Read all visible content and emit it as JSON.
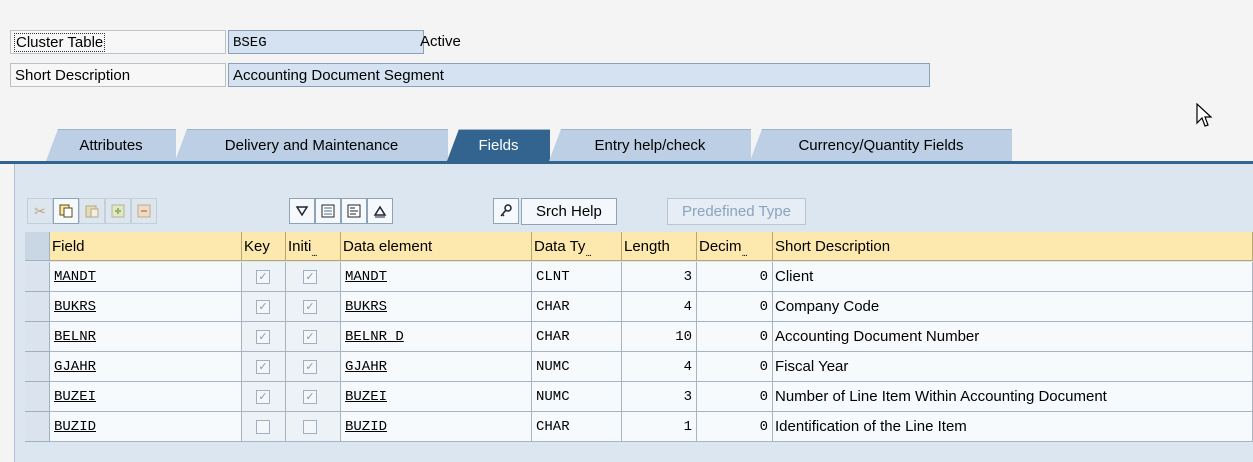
{
  "header": {
    "table_type_label": "Cluster Table",
    "table_name": "BSEG",
    "status": "Active",
    "short_desc_label": "Short Description",
    "short_desc_value": "Accounting Document Segment"
  },
  "tabs": [
    {
      "label": "Attributes",
      "active": false
    },
    {
      "label": "Delivery and Maintenance",
      "active": false
    },
    {
      "label": "Fields",
      "active": true
    },
    {
      "label": "Entry help/check",
      "active": false
    },
    {
      "label": "Currency/Quantity Fields",
      "active": false
    }
  ],
  "toolbar": {
    "icons": [
      "cut-icon",
      "copy-icon",
      "paste-icon",
      "insert-row-icon",
      "delete-row-icon",
      "find-icon",
      "include-icon",
      "append-structure-icon",
      "find-next-icon",
      "search-help-icon"
    ],
    "srch_help_label": "Srch Help",
    "predefined_type_label": "Predefined Type"
  },
  "table": {
    "columns": {
      "field": "Field",
      "key": "Key",
      "initial": "Initi",
      "data_element": "Data element",
      "data_type": "Data Ty",
      "length": "Length",
      "decimals": "Decim",
      "short_description": "Short Description"
    },
    "rows": [
      {
        "field": "MANDT",
        "key": true,
        "initial": true,
        "data_element": "MANDT",
        "data_type": "CLNT",
        "length": "3",
        "decimals": "0",
        "short_description": "Client"
      },
      {
        "field": "BUKRS",
        "key": true,
        "initial": true,
        "data_element": "BUKRS",
        "data_type": "CHAR",
        "length": "4",
        "decimals": "0",
        "short_description": "Company Code"
      },
      {
        "field": "BELNR",
        "key": true,
        "initial": true,
        "data_element": "BELNR_D",
        "data_type": "CHAR",
        "length": "10",
        "decimals": "0",
        "short_description": "Accounting Document Number"
      },
      {
        "field": "GJAHR",
        "key": true,
        "initial": true,
        "data_element": "GJAHR",
        "data_type": "NUMC",
        "length": "4",
        "decimals": "0",
        "short_description": "Fiscal Year"
      },
      {
        "field": "BUZEI",
        "key": true,
        "initial": true,
        "data_element": "BUZEI",
        "data_type": "NUMC",
        "length": "3",
        "decimals": "0",
        "short_description": "Number of Line Item Within Accounting Document"
      },
      {
        "field": "BUZID",
        "key": false,
        "initial": false,
        "data_element": "BUZID",
        "data_type": "CHAR",
        "length": "1",
        "decimals": "0",
        "short_description": "Identification of the Line Item"
      }
    ]
  },
  "colors": {
    "tab_active": "#33638f",
    "tab_inactive": "#bccfe4",
    "panel": "#dce6f0",
    "column_header": "#fde8ae",
    "input_bg": "#d4e2f1"
  }
}
